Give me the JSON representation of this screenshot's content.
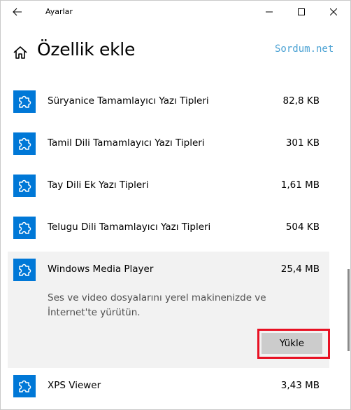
{
  "window": {
    "title": "Ayarlar"
  },
  "header": {
    "title": "Özellik ekle",
    "watermark": "Sordum.net"
  },
  "features": [
    {
      "name": "",
      "size": ""
    },
    {
      "name": "Süryanice Tamamlayıcı Yazı Tipleri",
      "size": "82,8 KB"
    },
    {
      "name": "Tamil Dili Tamamlayıcı Yazı Tipleri",
      "size": "301 KB"
    },
    {
      "name": "Tay Dili Ek Yazı Tipleri",
      "size": "1,61 MB"
    },
    {
      "name": "Telugu Dili Tamamlayıcı Yazı Tipleri",
      "size": "504 KB"
    },
    {
      "name": "Windows Media Player",
      "size": "25,4 MB",
      "description": "Ses ve video dosyalarını yerel makinenizde ve İnternet'te yürütün.",
      "install_label": "Yükle",
      "expanded": true
    },
    {
      "name": "XPS Viewer",
      "size": "3,43 MB"
    }
  ],
  "colors": {
    "accent": "#0078d7",
    "highlight": "#e81123",
    "watermark": "#4da3d4",
    "expanded_bg": "#f2f2f2"
  },
  "icons": {
    "back": "arrow-left-icon",
    "home": "home-icon",
    "feature": "puzzle-piece-icon",
    "minimize": "minimize-icon",
    "maximize": "maximize-icon",
    "close": "close-icon"
  }
}
